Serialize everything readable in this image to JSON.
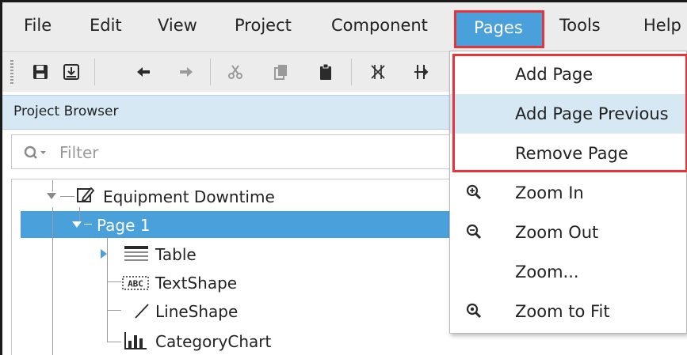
{
  "menubar": {
    "items": [
      "File",
      "Edit",
      "View",
      "Project",
      "Component",
      "Pages",
      "Tools",
      "Help"
    ],
    "active": "Pages"
  },
  "project_browser": {
    "title": "Project Browser",
    "filter_placeholder": "Filter",
    "tree": {
      "root": "Equipment Downtime",
      "page": "Page 1",
      "children": [
        "Table",
        "TextShape",
        "LineShape",
        "CategoryChart"
      ]
    }
  },
  "pages_menu": {
    "items": [
      {
        "label": "Add Page",
        "icon": ""
      },
      {
        "label": "Add Page Previous",
        "icon": ""
      },
      {
        "label": "Remove Page",
        "icon": ""
      },
      {
        "label": "Zoom In",
        "icon": "zoom-in-icon"
      },
      {
        "label": "Zoom Out",
        "icon": "zoom-out-icon"
      },
      {
        "label": "Zoom...",
        "icon": ""
      },
      {
        "label": "Zoom to Fit",
        "icon": "zoom-fit-icon"
      }
    ],
    "highlighted": "Add Page Previous"
  },
  "colors": {
    "accent": "#4aa0db",
    "highlight_box": "#e8333b",
    "header_bg": "#d7e8f5",
    "menubar_bg": "#ececec"
  }
}
